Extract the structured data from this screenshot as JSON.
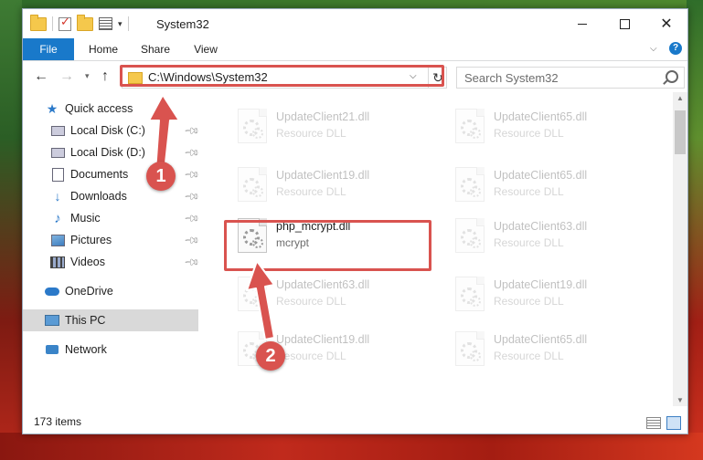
{
  "window": {
    "title": "System32"
  },
  "ribbon": {
    "tabs": [
      "File",
      "Home",
      "Share",
      "View"
    ],
    "help": "?"
  },
  "navigation": {
    "address": "C:\\Windows\\System32",
    "search_placeholder": "Search System32"
  },
  "sidebar": {
    "items": [
      {
        "label": "Quick access",
        "icon": "star-icon"
      },
      {
        "label": "Local Disk (C:)",
        "icon": "drive-icon",
        "pinned": true
      },
      {
        "label": "Local Disk (D:)",
        "icon": "drive-icon",
        "pinned": true
      },
      {
        "label": "Documents",
        "icon": "documents-icon",
        "pinned": true
      },
      {
        "label": "Downloads",
        "icon": "downloads-icon",
        "pinned": true
      },
      {
        "label": "Music",
        "icon": "music-icon",
        "pinned": true
      },
      {
        "label": "Pictures",
        "icon": "pictures-icon",
        "pinned": true
      },
      {
        "label": "Videos",
        "icon": "videos-icon",
        "pinned": true
      },
      {
        "label": "OneDrive",
        "icon": "onedrive-icon"
      },
      {
        "label": "This PC",
        "icon": "this-pc-icon",
        "selected": true
      },
      {
        "label": "Network",
        "icon": "network-icon"
      }
    ]
  },
  "files": [
    {
      "name": "UpdateClient21.dll",
      "type": "Resource DLL",
      "faded": true
    },
    {
      "name": "UpdateClient65.dll",
      "type": "Resource DLL",
      "faded": true
    },
    {
      "name": "UpdateClient19.dll",
      "type": "Resource DLL",
      "faded": true
    },
    {
      "name": "UpdateClient65.dll",
      "type": "Resource DLL",
      "faded": true
    },
    {
      "name": "php_mcrypt.dll",
      "type": "mcrypt",
      "faded": false
    },
    {
      "name": "UpdateClient63.dll",
      "type": "Resource DLL",
      "faded": true
    },
    {
      "name": "UpdateClient63.dll",
      "type": "Resource DLL",
      "faded": true
    },
    {
      "name": "UpdateClient19.dll",
      "type": "Resource DLL",
      "faded": true
    },
    {
      "name": "UpdateClient19.dll",
      "type": "Resource DLL",
      "faded": true
    },
    {
      "name": "UpdateClient65.dll",
      "type": "Resource DLL",
      "faded": true
    }
  ],
  "status": {
    "item_count": "173 items"
  },
  "annotations": {
    "step1": "1",
    "step2": "2",
    "color": "#d9534f"
  }
}
